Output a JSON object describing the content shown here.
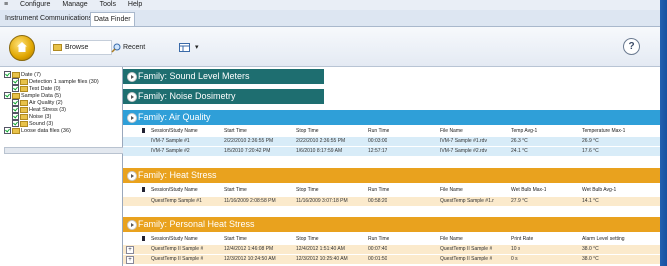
{
  "menu": {
    "items": [
      "≡",
      "Configure",
      "Manage",
      "Tools",
      "Help"
    ]
  },
  "tabs": [
    {
      "label": "Instrument Communications",
      "active": false
    },
    {
      "label": "Data Finder",
      "active": true
    }
  ],
  "toolbar": {
    "browse_label": "Browse",
    "recent_label": "Recent",
    "view_label": "▾",
    "help_label": "?"
  },
  "tree": [
    {
      "label": "Date (7)",
      "level": 0
    },
    {
      "label": "Detection 1 sample files (30)",
      "level": 1
    },
    {
      "label": "Test Date (0)",
      "level": 1
    },
    {
      "label": "Sample Data (5)",
      "level": 0
    },
    {
      "label": "Air Quality (2)",
      "level": 1
    },
    {
      "label": "Heat Stress (3)",
      "level": 1
    },
    {
      "label": "Noise (3)",
      "level": 1
    },
    {
      "label": "Sound (3)",
      "level": 1
    },
    {
      "label": "Loose data files (36)",
      "level": 0
    }
  ],
  "families": [
    {
      "label": "Family: Sound Level Meters",
      "color": "#1e6e70"
    },
    {
      "label": "Family: Noise Dosimetry",
      "color": "#1e6e70"
    },
    {
      "label": "Family: Air Quality",
      "color": "#2f9fd8",
      "row_bg": "#d8ecf8",
      "headers": [
        "Session/Study Name",
        "Start Time",
        "Stop Time",
        "Run Time",
        "File Name",
        "Temp Avg-1",
        "Temperature Max-1"
      ],
      "rows": [
        [
          "IVM-7 Sample #1",
          "2/22/2010 2:36:55 PM",
          "2/22/2010 2:36:55 PM",
          "00:03:00",
          "IVM-7 Sample #1.rdv",
          "26.3 °C",
          "26.9 °C"
        ],
        [
          "IVM-7 Sample #2",
          "1/5/2010 7:20:42 PM",
          "1/6/2010 8:17:59 AM",
          "12:57:17",
          "IVM-7 Sample #2.rdv",
          "24.1 °C",
          "17.6 °C"
        ]
      ]
    },
    {
      "label": "Family: Heat Stress",
      "color": "#e9a21e",
      "row_bg": "#fbeacc",
      "headers": [
        "Session/Study Name",
        "Start Time",
        "Stop Time",
        "Run Time",
        "File Name",
        "Wet Bulb Max-1",
        "Wet Bulb Avg-1"
      ],
      "rows": [
        [
          "QuestTemp Sample #1",
          "11/16/2009 2:08:58 PM",
          "11/16/2009 3:07:18 PM",
          "00:58:20",
          "QuestTemp Sample #1.r",
          "27.9 °C",
          "14.1 °C"
        ]
      ]
    },
    {
      "label": "Family: Personal Heat Stress",
      "color": "#e9a21e",
      "row_bg": "#fbeacc",
      "headers": [
        "Session/Study Name",
        "Start Time",
        "Stop Time",
        "Run Time",
        "File Name",
        "Print Rate",
        "Alarm Level setting"
      ],
      "rows": [
        [
          "QuestTemp II Sample #",
          "12/4/2012 1:46:08 PM",
          "12/4/2012 1:51:40 AM",
          "00:07:40",
          "QuestTemp II Sample #",
          "10 s",
          "38.0 °C"
        ],
        [
          "QuestTemp II Sample #",
          "12/3/2012 10:24:50 AM",
          "12/3/2012 10:25:40 AM",
          "00:01:50",
          "QuestTemp II Sample #",
          "0 s",
          "38.0 °C"
        ]
      ]
    }
  ]
}
